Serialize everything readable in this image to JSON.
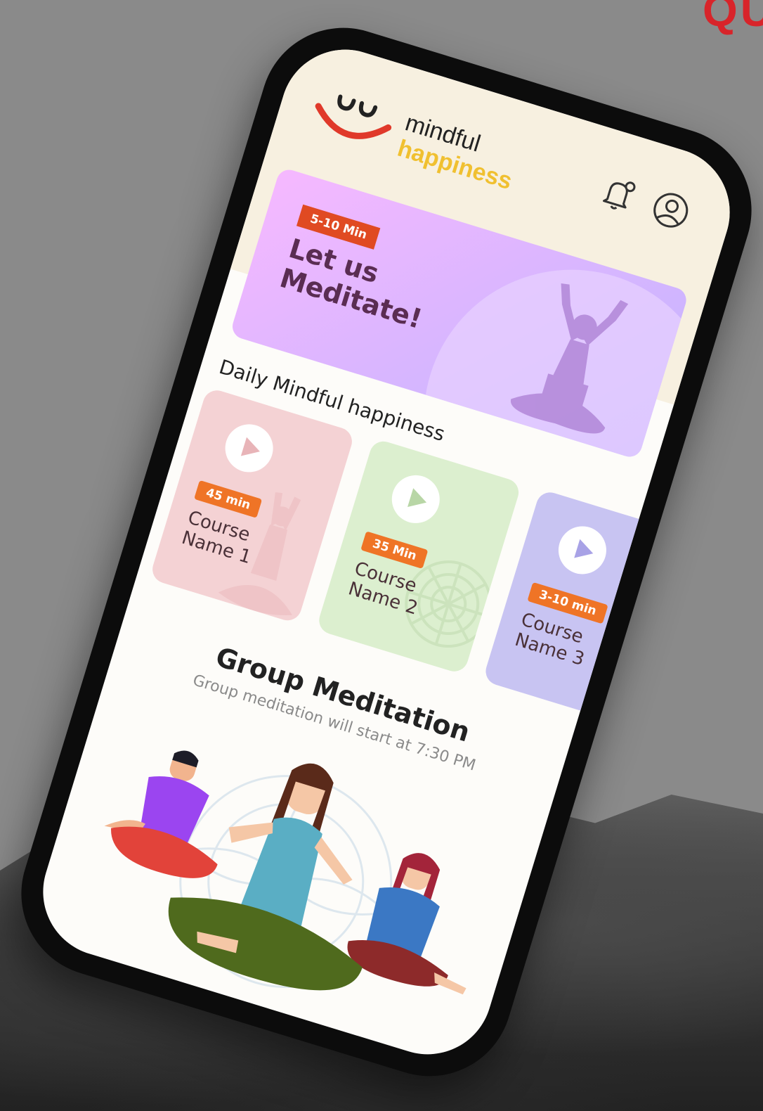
{
  "corner_text": "QU",
  "app": {
    "brand_line1": "mindful",
    "brand_line2": "happiness"
  },
  "header": {
    "icons": [
      "bell-icon",
      "user-icon"
    ]
  },
  "hero": {
    "badge": "5-10 Min",
    "title": "Let us Meditate!"
  },
  "daily": {
    "title": "Daily Mindful happiness",
    "cards": [
      {
        "duration": "45 min",
        "name": "Course Name 1",
        "color": "#f4d2d4"
      },
      {
        "duration": "35 Min",
        "name": "Course Name 2",
        "color": "#dcefcf"
      },
      {
        "duration": "3-10 min",
        "name": "Course Name 3",
        "color": "#c8c4f2"
      }
    ]
  },
  "group": {
    "title": "Group Meditation",
    "subtitle": "Group meditation will start at 7:30 PM"
  },
  "colors": {
    "accent_orange": "#ef7426",
    "badge_red": "#e04a22",
    "brand_yellow": "#f0c030",
    "background": "#8a8a8a"
  }
}
